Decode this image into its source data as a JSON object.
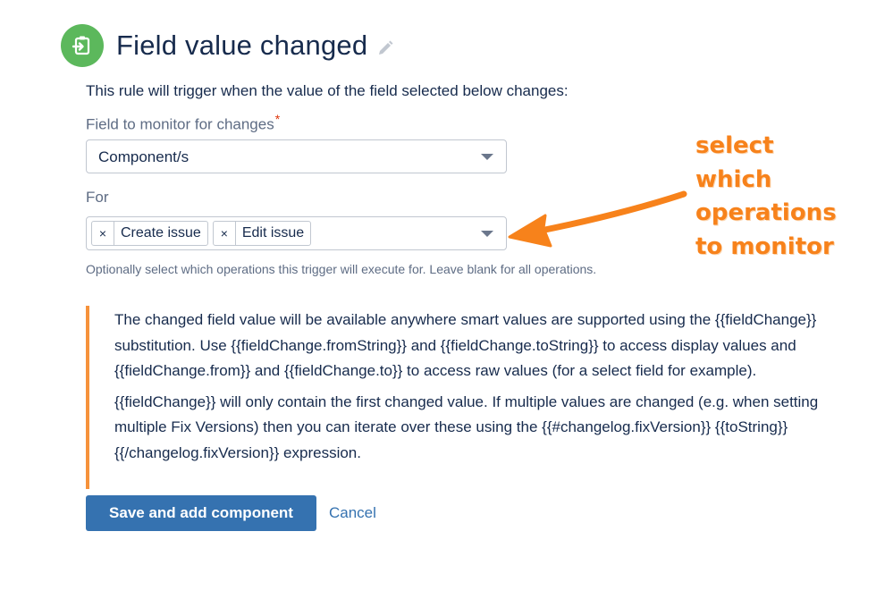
{
  "header": {
    "title": "Field value changed",
    "icon": "trigger-icon",
    "icon_color": "#5cb85c"
  },
  "description": "This rule will trigger when the value of the field selected below changes:",
  "field_monitor": {
    "label": "Field to monitor for changes",
    "required_mark": "*",
    "value": "Component/s"
  },
  "for_field": {
    "label": "For",
    "tags": [
      {
        "remove": "×",
        "label": "Create issue"
      },
      {
        "remove": "×",
        "label": "Edit issue"
      }
    ],
    "hint": "Optionally select which operations this trigger will execute for. Leave blank for all operations."
  },
  "info": {
    "paragraph1": "The changed field value will be available anywhere smart values are supported using the {{fieldChange}} substitution. Use {{fieldChange.fromString}} and {{fieldChange.toString}} to access display values and {{fieldChange.from}} and {{fieldChange.to}} to access raw values (for a select field for example).",
    "paragraph2": "{{fieldChange}} will only contain the first changed value. If multiple values are changed (e.g. when setting multiple Fix Versions) then you can iterate over these using the {{#changelog.fixVersion}} {{toString}}{{/changelog.fixVersion}} expression.",
    "accent_color": "#f6923b"
  },
  "actions": {
    "save_label": "Save and add component",
    "cancel_label": "Cancel",
    "primary_color": "#3572b0"
  },
  "annotation": {
    "text": "select\nwhich\noperations\nto monitor",
    "color": "#f7821b"
  }
}
